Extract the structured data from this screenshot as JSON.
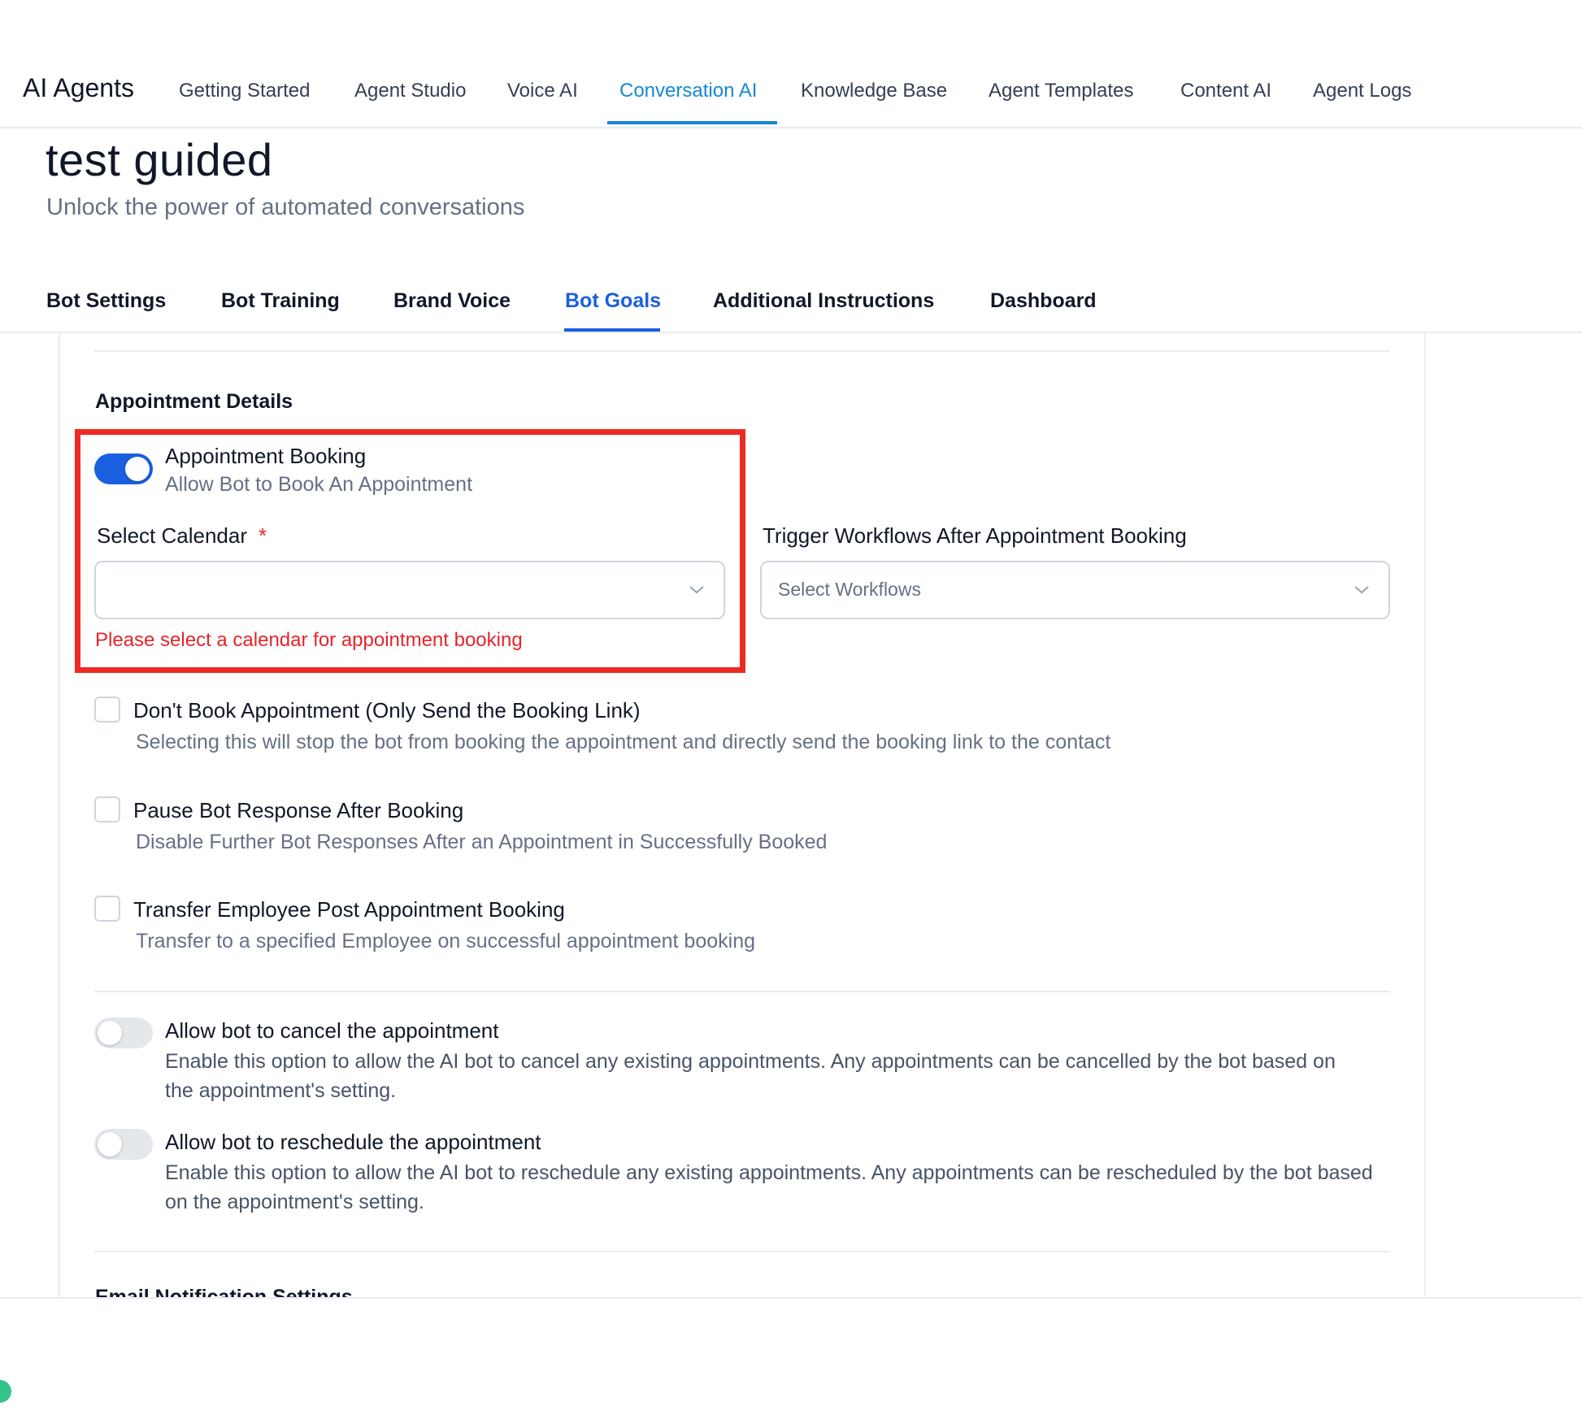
{
  "header": {
    "brand": "AI Agents",
    "nav": [
      {
        "label": "Getting Started"
      },
      {
        "label": "Agent Studio"
      },
      {
        "label": "Voice AI"
      },
      {
        "label": "Conversation AI",
        "active": true
      },
      {
        "label": "Knowledge Base"
      },
      {
        "label": "Agent Templates"
      },
      {
        "label": "Content AI"
      },
      {
        "label": "Agent Logs"
      }
    ],
    "active_color": "#1589d1"
  },
  "page": {
    "title": "test guided",
    "subtitle": "Unlock the power of automated conversations"
  },
  "tabs": [
    {
      "label": "Bot Settings"
    },
    {
      "label": "Bot Training"
    },
    {
      "label": "Brand Voice"
    },
    {
      "label": "Bot Goals",
      "active": true
    },
    {
      "label": "Additional Instructions"
    },
    {
      "label": "Dashboard"
    }
  ],
  "appointment": {
    "section_title": "Appointment Details",
    "booking": {
      "label": "Appointment Booking",
      "description": "Allow Bot to Book An Appointment",
      "enabled": true
    },
    "calendar": {
      "label": "Select Calendar",
      "required_mark": "*",
      "value": "",
      "error": "Please select a calendar for appointment booking"
    },
    "workflows": {
      "label": "Trigger Workflows After Appointment Booking",
      "placeholder": "Select Workflows"
    },
    "checkboxes": [
      {
        "label": "Don't Book Appointment (Only Send the Booking Link)",
        "description": "Selecting this will stop the bot from booking the appointment and directly send the booking link to the contact",
        "checked": false
      },
      {
        "label": "Pause Bot Response After Booking",
        "description": "Disable Further Bot Responses After an Appointment in Successfully Booked",
        "checked": false
      },
      {
        "label": "Transfer Employee Post Appointment Booking",
        "description": "Transfer to a specified Employee on successful appointment booking",
        "checked": false
      }
    ],
    "toggles": [
      {
        "label": "Allow bot to cancel the appointment",
        "description": "Enable this option to allow the AI bot to cancel any existing appointments. Any appointments can be cancelled by the bot based on the appointment's setting.",
        "enabled": false
      },
      {
        "label": "Allow bot to reschedule the appointment",
        "description": "Enable this option to allow the AI bot to reschedule any existing appointments. Any appointments can be rescheduled by the bot based on the appointment's setting.",
        "enabled": false
      }
    ],
    "next_section_title": "Email Notification Settings"
  },
  "colors": {
    "accent": "#1a5fe0",
    "error": "#e5252a",
    "highlight": "#ee2a24"
  },
  "icons": {
    "select_chevron": "chevron-down-icon"
  }
}
